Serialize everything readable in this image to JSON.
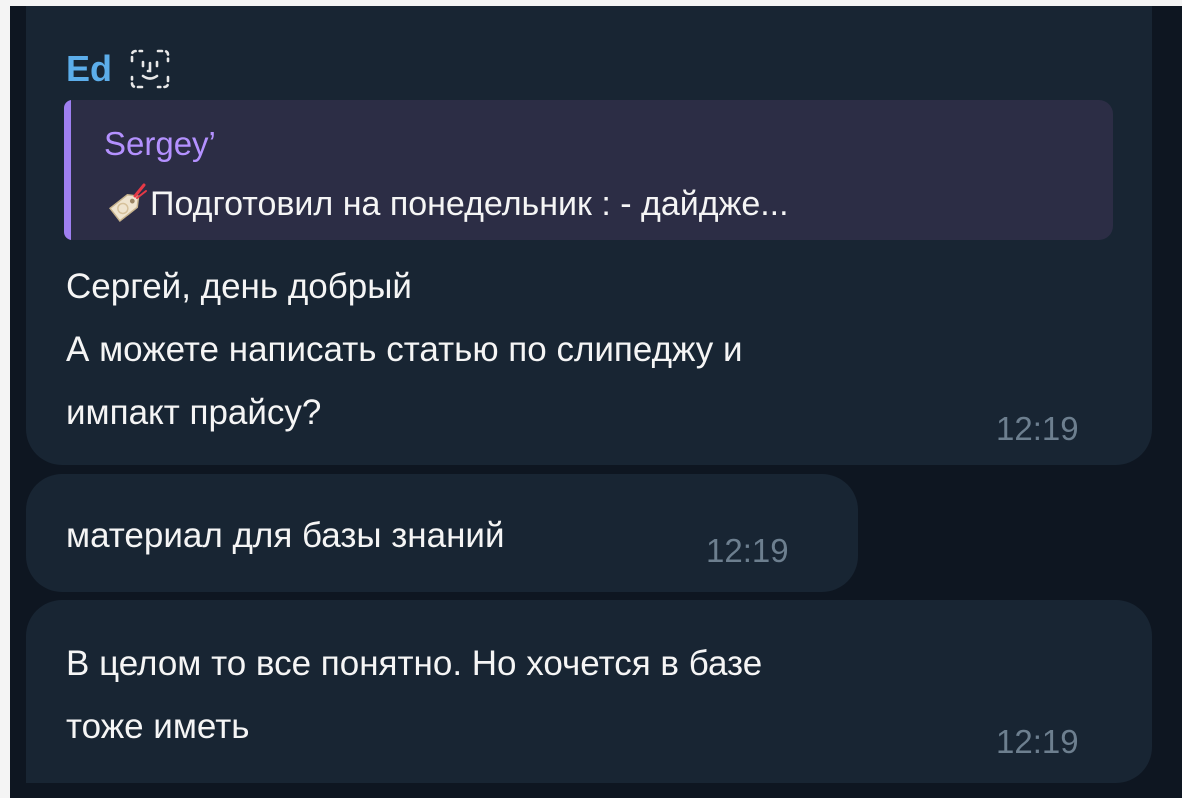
{
  "messages": [
    {
      "sender": "Ed",
      "reply": {
        "author": "Sergey’",
        "text": "Подготовил на понедельник : - дайдже..."
      },
      "lines": [
        "Сергей, день добрый",
        "А можете написать статью по слипеджу и",
        "импакт прайсу?"
      ],
      "time": "12:19"
    },
    {
      "lines": [
        "материал для базы знаний"
      ],
      "time": "12:19"
    },
    {
      "lines": [
        "В целом то все понятно. Но хочется в базе",
        "тоже иметь"
      ],
      "time": "12:19"
    }
  ],
  "colors": {
    "background": "#0e1621",
    "bubble": "#182533",
    "sender_name": "#5cadea",
    "reply_background": "#2c2d45",
    "reply_bar": "#9e7ff0",
    "reply_author": "#b491ff",
    "text": "#f5f5f5",
    "time": "#6d7f8f"
  },
  "icons": {
    "sender_badge": "face-id-icon",
    "reply_emoji": "tag-label-icon"
  }
}
